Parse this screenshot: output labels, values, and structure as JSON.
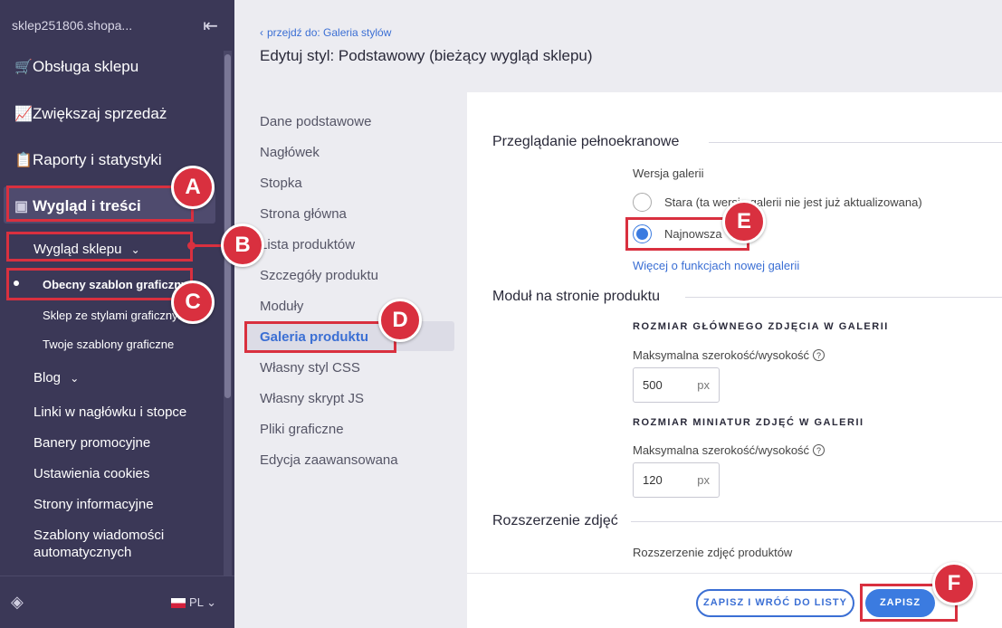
{
  "sidebar": {
    "store_name": "sklep251806.shopa...",
    "menu": [
      {
        "label": "Obsługa sklepu",
        "icon": "cart-icon"
      },
      {
        "label": "Zwiększaj sprzedaż",
        "icon": "chart-icon"
      },
      {
        "label": "Raporty i statystyki",
        "icon": "clipboard-icon"
      },
      {
        "label": "Wygląd i treści",
        "icon": "image-icon"
      }
    ],
    "sub": {
      "wyglad_sklepu": "Wygląd sklepu",
      "obecny": "Obecny szablon graficzny",
      "styl": "Sklep ze stylami graficznymi",
      "twoje": "Twoje szablony graficzne",
      "blog": "Blog",
      "links": "Linki w nagłówku i stopce",
      "banery": "Banery promocyjne",
      "cookies": "Ustawienia cookies",
      "strony": "Strony informacyjne",
      "szablony_1": "Szablony wiadomości",
      "szablony_2": "automatycznych"
    },
    "lang": "PL"
  },
  "header": {
    "back": "przejdź do: Galeria stylów",
    "title": "Edytuj styl: Podstawowy (bieżący wygląd sklepu)"
  },
  "subnav": [
    "Dane podstawowe",
    "Nagłówek",
    "Stopka",
    "Strona główna",
    "Lista produktów",
    "Szczegóły produktu",
    "Moduły",
    "Galeria produktu",
    "Własny styl CSS",
    "Własny skrypt JS",
    "Pliki graficzne",
    "Edycja zaawansowana"
  ],
  "content": {
    "s1_title": "Przeglądanie pełnoekranowe",
    "s1_label": "Wersja galerii",
    "opt_old": "Stara (ta wersja galerii nie jest już aktualizowana)",
    "opt_new": "Najnowsza",
    "more_link": "Więcej o funkcjach nowej galerii",
    "s2_title": "Moduł na stronie produktu",
    "main_caps": "ROZMIAR GŁÓWNEGO ZDJĘCIA W GALERII",
    "max_label": "Maksymalna szerokość/wysokość",
    "main_value": "500",
    "unit": "px",
    "thumb_caps": "ROZMIAR MINIATUR ZDJĘĆ W GALERII",
    "thumb_value": "120",
    "s3_title": "Rozszerzenie zdjęć",
    "s3_label": "Rozszerzenie zdjęć produktów"
  },
  "footer": {
    "save_back": "ZAPISZ I WRÓĆ DO LISTY",
    "save": "ZAPISZ"
  },
  "annotations": [
    "A",
    "B",
    "C",
    "D",
    "E",
    "F"
  ],
  "colors": {
    "sidebar": "#3b3857",
    "accent": "#3b7be0",
    "annotation": "#d9303f"
  }
}
